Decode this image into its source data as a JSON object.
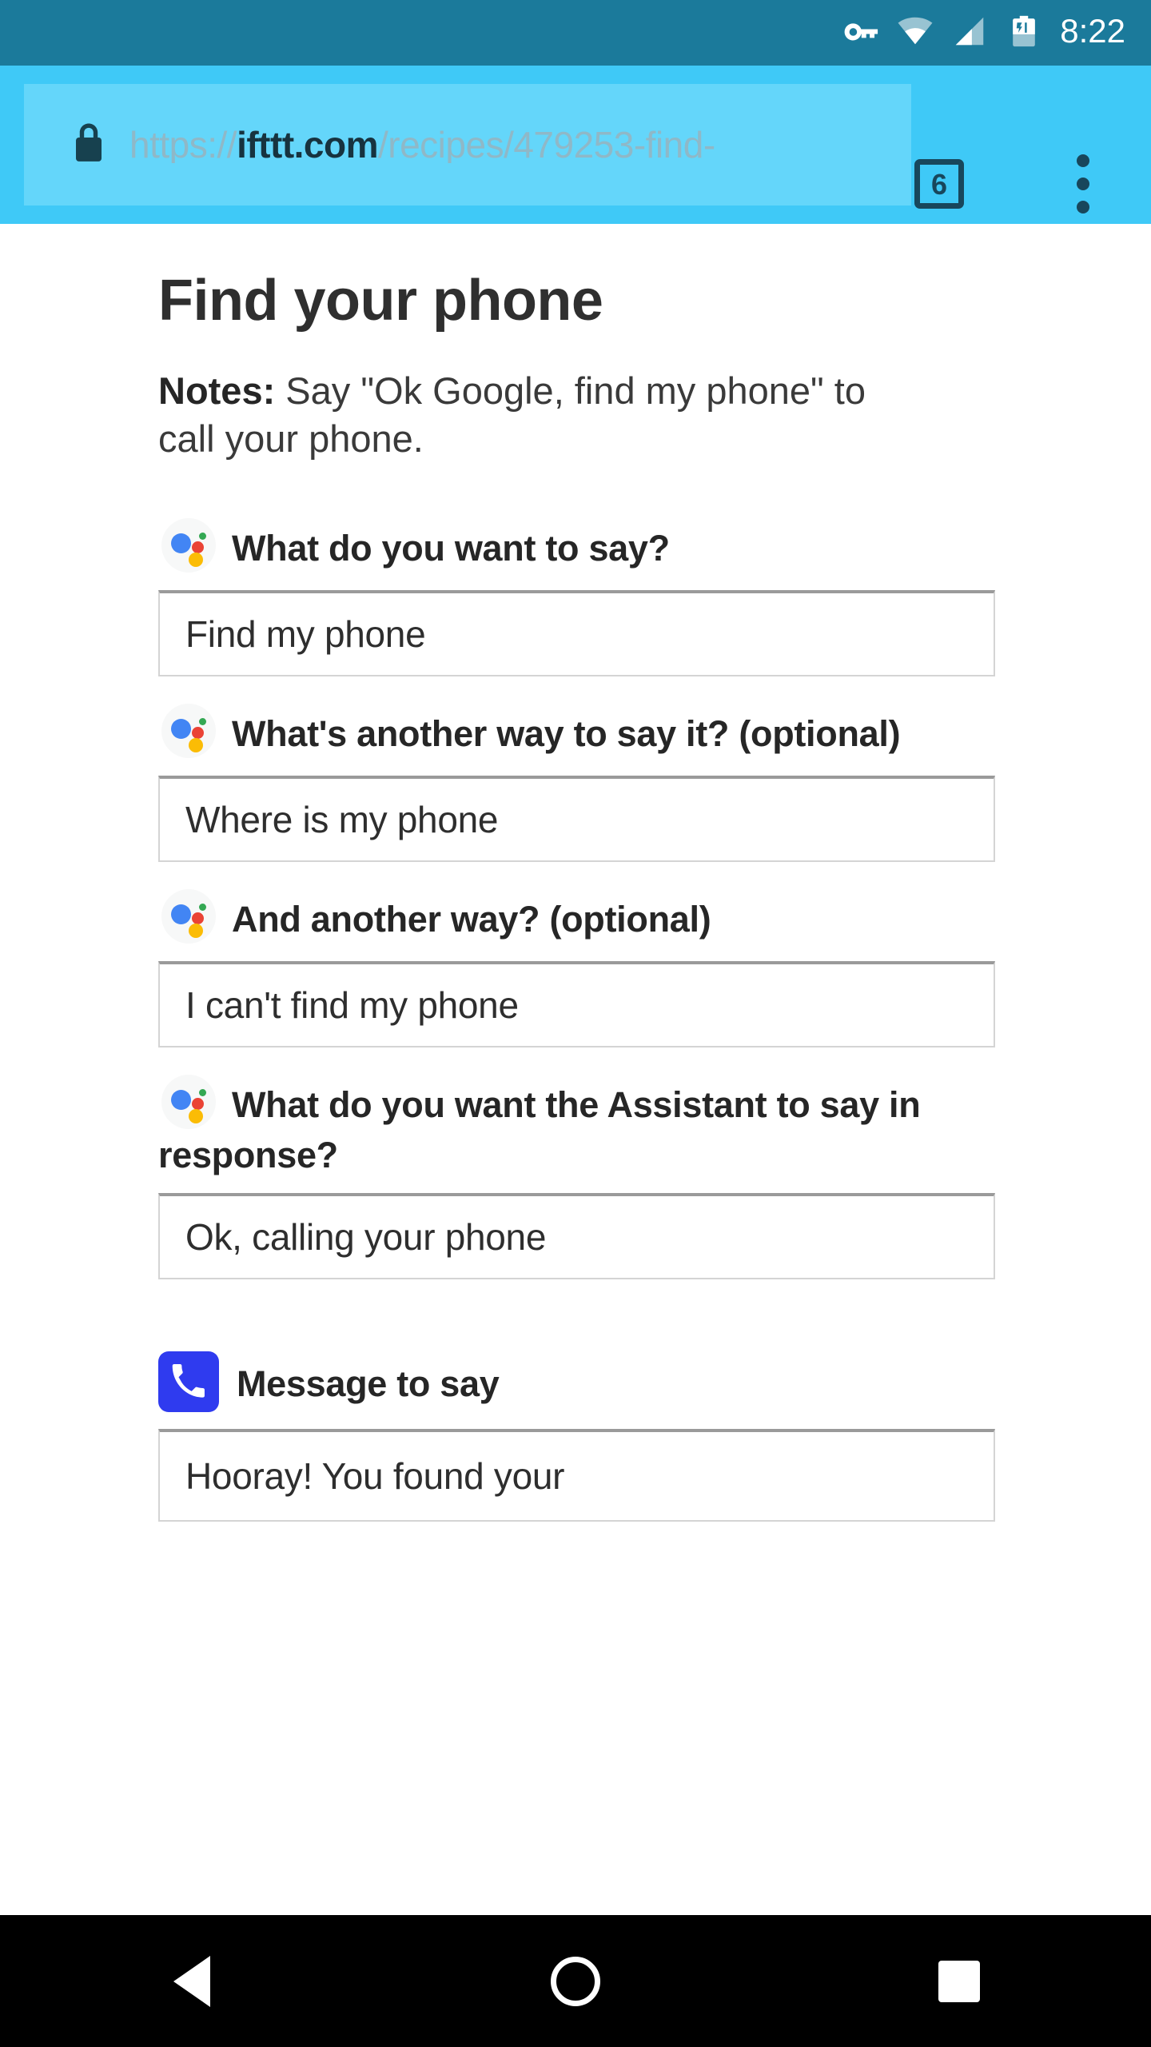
{
  "status_bar": {
    "time": "8:22",
    "icons": [
      "vpn-key-icon",
      "wifi-icon",
      "cell-signal-icon",
      "battery-icon"
    ],
    "background_color": "#1b7a9b"
  },
  "browser": {
    "url_scheme": "https://",
    "url_host": "ifttt.com",
    "url_path": "/recipes/479253-find-",
    "url_full": "https://ifttt.com/recipes/479253-find-",
    "lock_icon": "lock-icon",
    "tab_count": "6",
    "menu_icon": "overflow-menu-icon",
    "toolbar_color": "#3fc9f7",
    "omnibox_color": "#64d6fa"
  },
  "page": {
    "title": "Find your phone",
    "notes_label": "Notes:",
    "notes_text": " Say \"Ok Google, find my phone\" to call your phone.",
    "fields": [
      {
        "icon": "google-assistant-icon",
        "label": "What do you want to say?",
        "value": "Find my phone",
        "placeholder": ""
      },
      {
        "icon": "google-assistant-icon",
        "label": "What's another way to say it? (optional)",
        "value": "Where is my phone",
        "placeholder": ""
      },
      {
        "icon": "google-assistant-icon",
        "label": "And another way? (optional)",
        "value": "I can't find my phone",
        "placeholder": ""
      },
      {
        "icon": "google-assistant-icon",
        "label": "What do you want the Assistant to say in response?",
        "value": "Ok, calling your phone",
        "placeholder": ""
      }
    ],
    "action_section": {
      "icon": "phone-call-icon",
      "icon_color": "#2f3bef",
      "label": "Message to say",
      "value": "Hooray! You found your",
      "placeholder": ""
    }
  },
  "nav_bar": {
    "back_label": "Back",
    "home_label": "Home",
    "recents_label": "Recent apps",
    "background_color": "#000000"
  }
}
